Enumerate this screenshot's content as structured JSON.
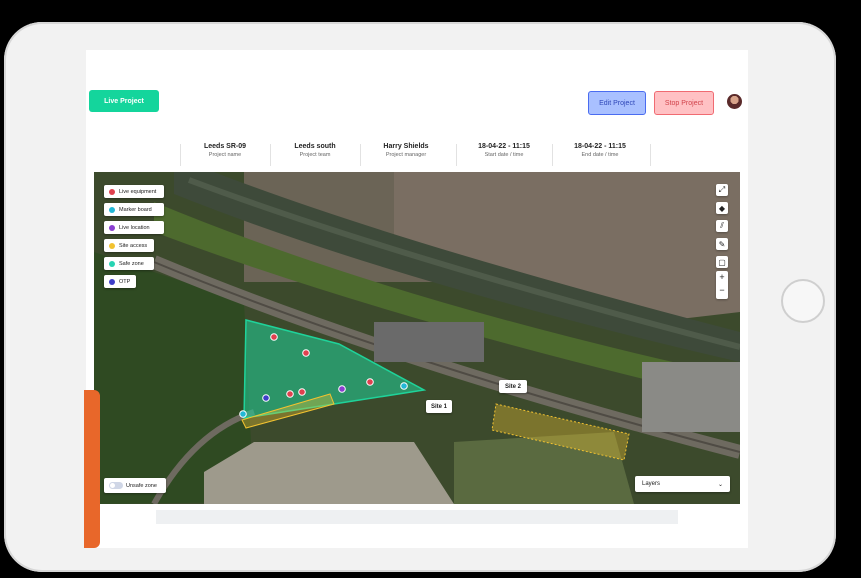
{
  "header": {
    "live_project_label": "Live Project",
    "edit_project_label": "Edit Project",
    "stop_project_label": "Stop Project"
  },
  "project_info": [
    {
      "value": "Leeds SR-09",
      "label": "Project name"
    },
    {
      "value": "Leeds south",
      "label": "Project team"
    },
    {
      "value": "Harry Shields",
      "label": "Project manager"
    },
    {
      "value": "18-04-22  -  11:15",
      "label": "Start date / time"
    },
    {
      "value": "18-04-22  -  11:15",
      "label": "End date / time"
    }
  ],
  "legend": [
    {
      "label": "Live equipment",
      "color": "#e0414f"
    },
    {
      "label": "Marker board",
      "color": "#23b8d6"
    },
    {
      "label": "Live location",
      "color": "#8a3fd1"
    },
    {
      "label": "Site access",
      "color": "#f2c230"
    },
    {
      "label": "Safe zone",
      "color": "#27d4b3"
    },
    {
      "label": "OTP",
      "color": "#3e3ec9"
    }
  ],
  "map": {
    "site1_label": "Site 1",
    "site2_label": "Site 2",
    "unsafe_zone_label": "Unsafe zone",
    "layers_label": "Layers",
    "safe_zone_color": "#1fd39a",
    "access_zone_color": "#f2c230",
    "controls": {
      "fullscreen_icon": "expand-icon",
      "locate_icon": "locate-icon",
      "hatch_icon": "hatch-tool-icon",
      "draw_icon": "pencil-icon",
      "square_icon": "square-tool-icon",
      "zoom_in": "+",
      "zoom_out": "−"
    }
  }
}
